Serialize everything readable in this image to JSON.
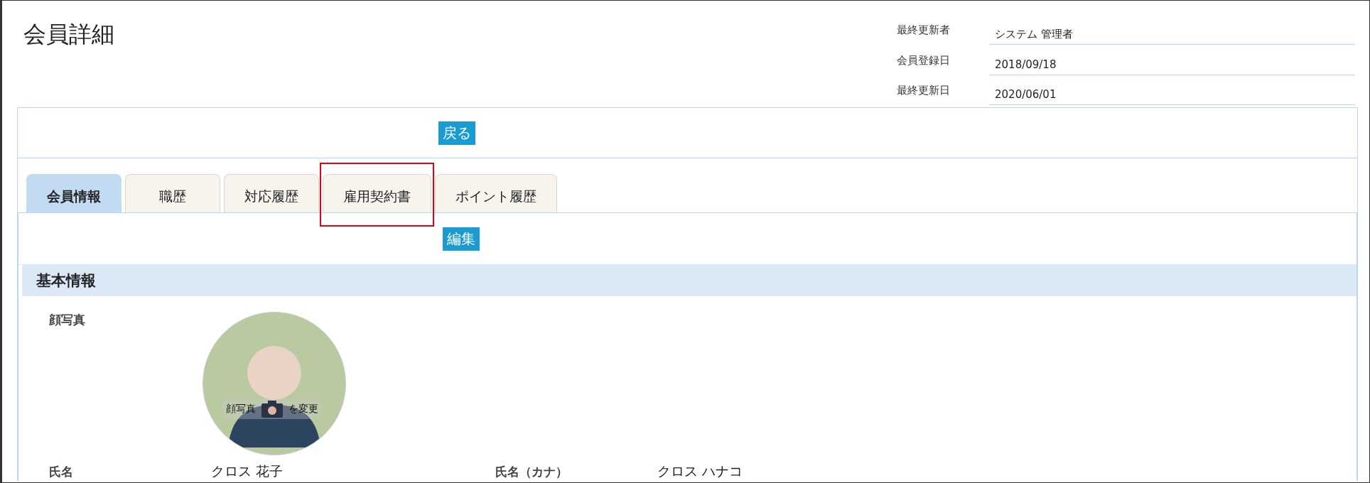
{
  "page_title": "会員詳細",
  "meta": [
    {
      "label": "最終更新者",
      "value": "システム 管理者"
    },
    {
      "label": "会員登録日",
      "value": "2018/09/18"
    },
    {
      "label": "最終更新日",
      "value": "2020/06/01"
    }
  ],
  "back_button": "戻る",
  "tabs": [
    {
      "label": "会員情報",
      "selected": true,
      "highlighted": false
    },
    {
      "label": "職歴",
      "selected": false,
      "highlighted": false
    },
    {
      "label": "対応履歴",
      "selected": false,
      "highlighted": false
    },
    {
      "label": "雇用契約書",
      "selected": false,
      "highlighted": true
    },
    {
      "label": "ポイント履歴",
      "selected": false,
      "highlighted": false
    }
  ],
  "edit_button": "編集",
  "section": {
    "title": "基本情報",
    "photo": {
      "label": "顔写真",
      "change_text_before": "顔写真",
      "change_text_after": "を変更"
    },
    "fields": [
      {
        "label": "氏名",
        "value": "クロス 花子"
      },
      {
        "label": "氏名（カナ）",
        "value": "クロス ハナコ"
      }
    ]
  }
}
